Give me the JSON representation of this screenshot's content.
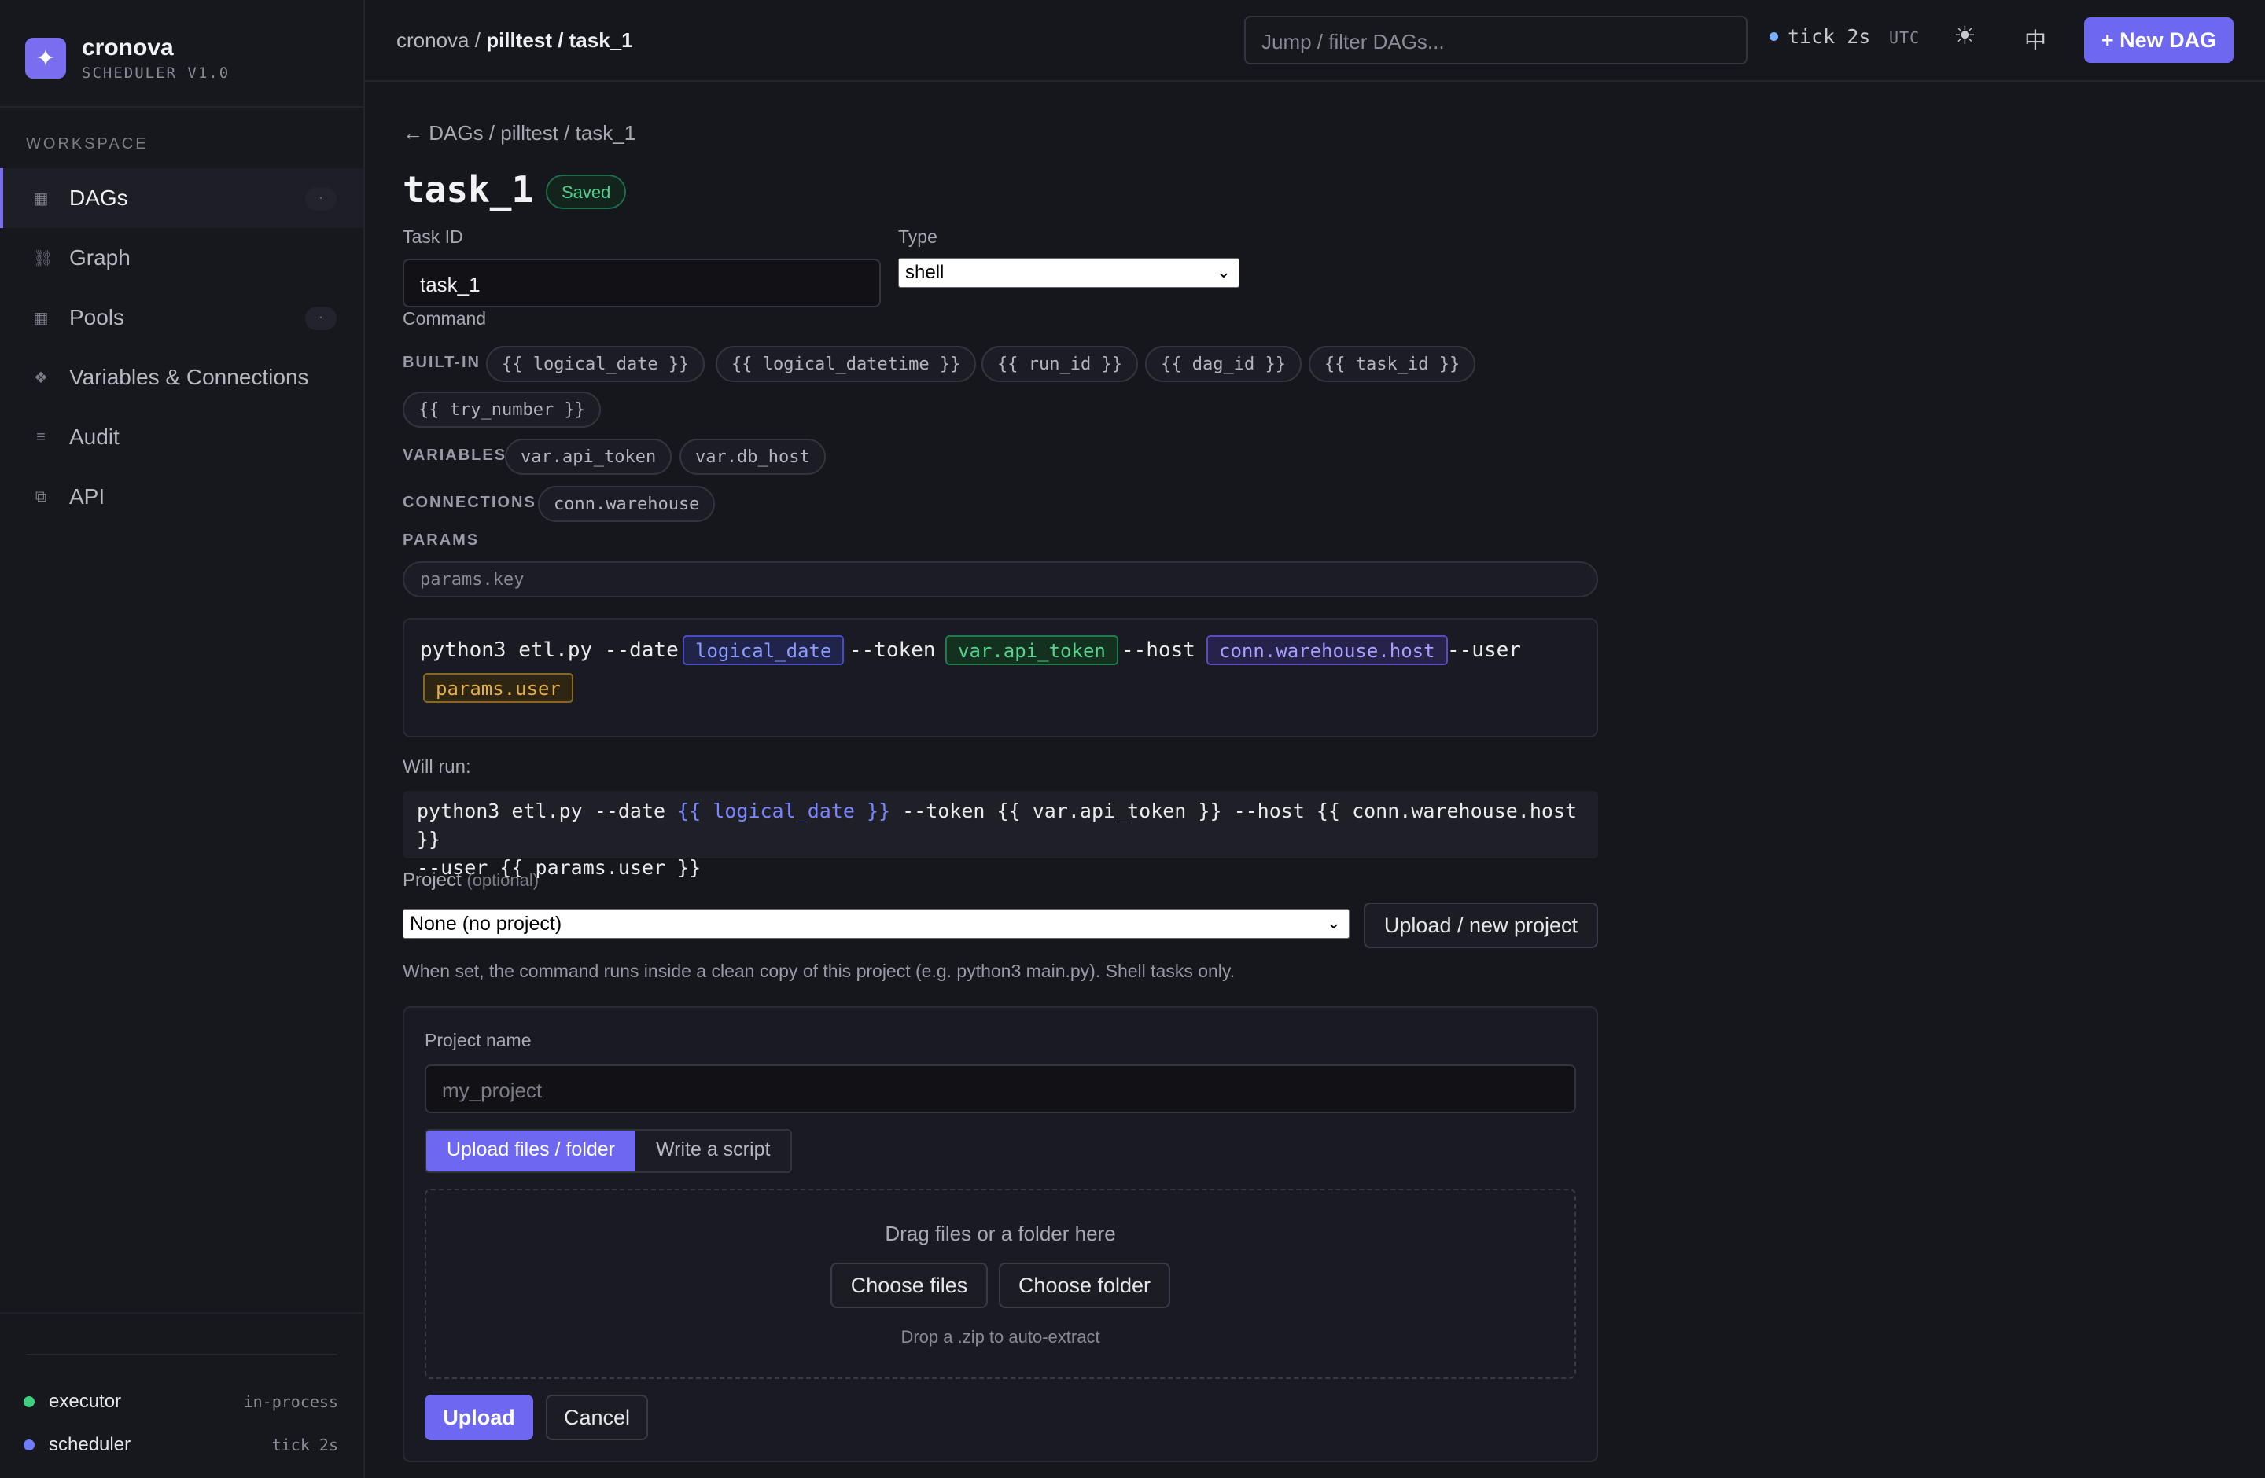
{
  "brand": {
    "name": "cronova",
    "sub": "SCHEDULER V1.0",
    "logo_icon": "sparkle-icon"
  },
  "sidebar": {
    "section": "WORKSPACE",
    "items": [
      {
        "label": "DAGs",
        "icon": "grid-icon",
        "badge": "·",
        "active": true
      },
      {
        "label": "Graph",
        "icon": "graph-icon"
      },
      {
        "label": "Pools",
        "icon": "pool-icon",
        "badge": "·"
      },
      {
        "label": "Variables & Connections",
        "icon": "variables-icon"
      },
      {
        "label": "Audit",
        "icon": "list-icon"
      },
      {
        "label": "API",
        "icon": "api-icon"
      }
    ],
    "status": [
      {
        "name": "executor",
        "value": "in-process",
        "color": "#3ecf7e"
      },
      {
        "name": "scheduler",
        "value": "tick 2s",
        "color": "#6e7cff"
      }
    ]
  },
  "topbar": {
    "crumb_root": "cronova /",
    "crumb_path": "pilltest / task_1",
    "search_placeholder": "Jump / filter DAGs...",
    "tick": "tick 2s",
    "tz": "UTC",
    "theme_icon": "☀",
    "lang": "中",
    "new_dag": "+ New DAG"
  },
  "page": {
    "back": "← DAGs / pilltest / task_1",
    "title": "task_1",
    "status": "Saved",
    "task_id_label": "Task ID",
    "task_id_value": "task_1",
    "type_label": "Type",
    "type_value": "shell",
    "command_label": "Command",
    "builtin_label": "BUILT-IN",
    "builtins": [
      "{{ logical_date }}",
      "{{ logical_datetime }}",
      "{{ run_id }}",
      "{{ dag_id }}",
      "{{ task_id }}",
      "{{ try_number }}"
    ],
    "variables_label": "VARIABLES",
    "variables": [
      "var.api_token",
      "var.db_host"
    ],
    "connections_label": "CONNECTIONS",
    "connections": [
      "conn.warehouse"
    ],
    "params_label": "PARAMS",
    "params_placeholder": "params.key",
    "command": {
      "p1": "python3 etl.py --date",
      "t1": "logical_date",
      "p2": "--token",
      "t2": "var.api_token",
      "p3": "--host",
      "t3": "conn.warehouse.host",
      "p4": "--user",
      "t4": "params.user"
    },
    "will_run_label": "Will run:",
    "will_run": {
      "a": "python3 etl.py --date ",
      "b": "{{ logical_date }}",
      "c": " --token {{ var.api_token }} --host {{ conn.warehouse.host }}",
      "d": "--user {{ params.user }}"
    },
    "project_label": "Project",
    "project_optional": "(optional)",
    "project_value": "None (no project)",
    "upload_new_project": "Upload / new project",
    "project_hint": "When set, the command runs inside a clean copy of this project (e.g. python3 main.py). Shell tasks only.",
    "project_name_label": "Project name",
    "project_name_placeholder": "my_project",
    "tab_upload": "Upload files / folder",
    "tab_script": "Write a script",
    "drop_text": "Drag files or a folder here",
    "choose_files": "Choose files",
    "choose_folder": "Choose folder",
    "drop_zip": "Drop a .zip to auto-extract",
    "upload": "Upload",
    "cancel": "Cancel"
  }
}
